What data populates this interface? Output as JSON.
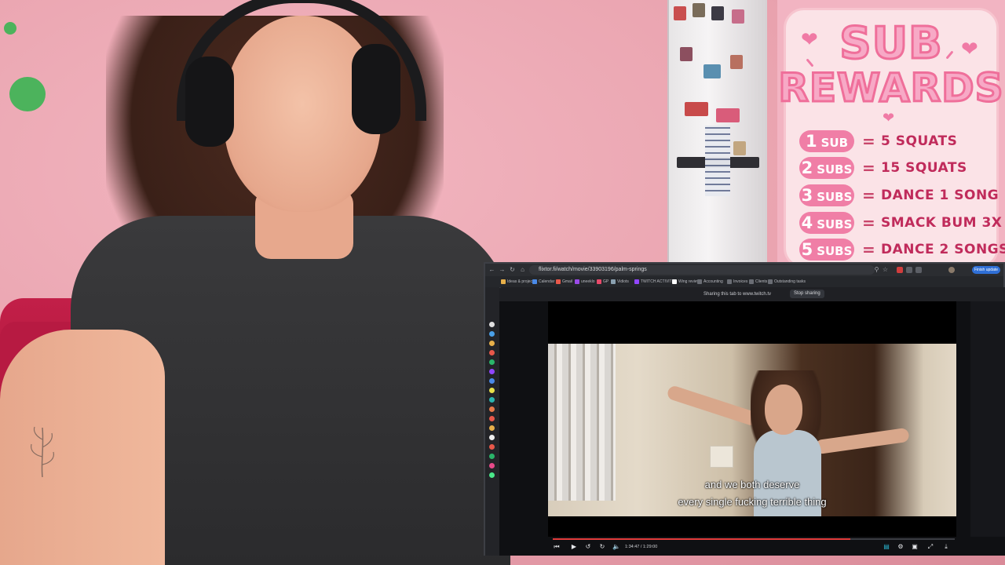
{
  "rewards": {
    "title_line1": "SUB",
    "title_line2": "REWARDS",
    "items": [
      {
        "num": "1",
        "unit": "SUB",
        "reward": "5 SQUATS"
      },
      {
        "num": "2",
        "unit": "SUBS",
        "reward": "15 SQUATS"
      },
      {
        "num": "3",
        "unit": "SUBS",
        "reward": "DANCE 1 SONG"
      },
      {
        "num": "4",
        "unit": "SUBS",
        "reward": "SMACK BUM 3X"
      },
      {
        "num": "5",
        "unit": "SUBS",
        "reward": "DANCE 2 SONGS"
      }
    ],
    "equals": "=",
    "colors": {
      "pill": "#f07ea6",
      "text": "#c02b5b",
      "title_outline": "#ef6f9a"
    }
  },
  "browser": {
    "url": "flixtor.fi/watch/movie/33903196/palm-springs",
    "profile_label": "Finish update",
    "share_text": "Sharing this tab to www.twitch.tv",
    "stop_sharing_label": "Stop sharing",
    "bookmarks": [
      "Ideas & projects",
      "Calendar",
      "Gmail",
      "uneeklo",
      "GP",
      "Vidiots",
      "TWITCH ACTIVITY",
      "Wing review",
      "Accounting",
      "Invoices",
      "Clients",
      "Outstanding tasks"
    ]
  },
  "player": {
    "subtitle_line1": "and we both deserve",
    "subtitle_line2": "every single fucking terrible thing",
    "time_display": "1:34:47 / 1:29:00",
    "progress": 0.74,
    "accent": "#e23b3b"
  }
}
